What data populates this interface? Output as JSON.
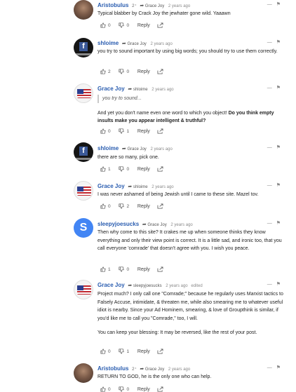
{
  "comments": [
    {
      "author": "Aristobulus",
      "badge": "2⁺",
      "reply_to": "Grace Joy",
      "time": "2 years ago",
      "edited": "",
      "text": "Typical blabber by Crack Joy the jewhater gone wild. Yaaawn",
      "up": "0",
      "down": "0",
      "reply": "Reply",
      "avatar": "photo"
    },
    {
      "author": "shloime",
      "badge": "",
      "reply_to": "Grace Joy",
      "time": "2 years ago",
      "edited": "",
      "text": "you try to sound important by using big words; you should try to use them correctly.",
      "up": "2",
      "down": "0",
      "reply": "Reply",
      "avatar": "fb"
    },
    {
      "author": "Grace Joy",
      "badge": "",
      "reply_to": "shloime",
      "time": "2 years ago",
      "edited": "",
      "quote": "you try to sound...",
      "text": "And yet you don't name even one word to which you object! ",
      "text_bold": "Do you think empty insults make you appear intelligent & truthful?",
      "up": "0",
      "down": "1",
      "reply": "Reply",
      "avatar": "flag"
    },
    {
      "author": "shloime",
      "badge": "",
      "reply_to": "Grace Joy",
      "time": "2 years ago",
      "edited": "",
      "text": "there are so many, pick one.",
      "up": "1",
      "down": "0",
      "reply": "Reply",
      "avatar": "fb"
    },
    {
      "author": "Grace Joy",
      "badge": "",
      "reply_to": "shloime",
      "time": "2 years ago",
      "edited": "",
      "text": "I was never ashamed of being Jewish until I came to these site. Mazel tov.",
      "up": "0",
      "down": "2",
      "reply": "Reply",
      "avatar": "flag"
    },
    {
      "author": "sleepyjoesucks",
      "badge": "",
      "reply_to": "Grace Joy",
      "time": "2 years ago",
      "edited": "",
      "text": "Then why come to this site? It crakes me up when someone thinks they know everything and only their view point is correct. It is a little sad, and ironic too, that you call everyone 'comrade' that doesn't agree with you. I wish you peace.",
      "up": "1",
      "down": "0",
      "reply": "Reply",
      "avatar": "s"
    },
    {
      "author": "Grace Joy",
      "badge": "",
      "reply_to": "sleepyjoesucks",
      "time": "2 years ago",
      "edited": "edited",
      "text": "Project much? I only call one \"Comrade;\" because he regularly uses Marxist tactics to Falsely Accuse, intimidate, & threaten me, while also smearing me to whatever useful idiot is nearby. Since your Ad Hominem, smearing, & love of Groupthink is similar, if you'd like me to call you \"Comrade,\" too, I will.",
      "text2": "You can keep your blessing: It may be reversed, like the rest of your post.",
      "up": "0",
      "down": "1",
      "reply": "Reply",
      "avatar": "flag"
    },
    {
      "author": "Aristobulus",
      "badge": "2⁺",
      "reply_to": "Grace Joy",
      "time": "2 years ago",
      "edited": "",
      "text": "RETURN TO GOD, he is the only one who can help.",
      "up": "0",
      "down": "0",
      "reply": "Reply",
      "avatar": "photo"
    }
  ],
  "controls": {
    "collapse": "—",
    "flag": "⚑"
  }
}
